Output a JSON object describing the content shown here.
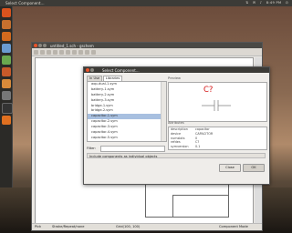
{
  "desktop_panel": {
    "title": "Select Component...",
    "tray": [
      "8:49 PM"
    ]
  },
  "main_window": {
    "title": "untitled_1.sch - gschem",
    "status": {
      "left": "Pick",
      "middle": "Stroke/Repeat/none",
      "right_a": "Grid(100, 100)",
      "right_b": "Component Mode"
    }
  },
  "dialog": {
    "title": "Select Component...",
    "tabs": [
      "In Use",
      "Libraries"
    ],
    "list_items": [
      "aop-dual-1.sym",
      "battery-1.sym",
      "battery-2.sym",
      "battery-3.sym",
      "bridge-1.sym",
      "bridge-2.sym",
      "capacitor-1.sym",
      "capacitor-2.sym",
      "capacitor-3.sym",
      "capacitor-4.sym",
      "capacitor-5.sym"
    ],
    "selected_index": 6,
    "filter_label": "Filter:",
    "filter_value": "",
    "preview_label": "Preview",
    "preview_refdes": "C?",
    "attributes_label": "Attributes",
    "attributes": [
      {
        "name": "description",
        "value": "capacitor"
      },
      {
        "name": "device",
        "value": "CAPACITOR"
      },
      {
        "name": "numslots",
        "value": "0"
      },
      {
        "name": "refdes",
        "value": "C?"
      },
      {
        "name": "symversion",
        "value": "0.1"
      }
    ],
    "option_label": "Include components as individual objects",
    "buttons": {
      "close": "Close",
      "ok": "OK"
    }
  },
  "colors": {
    "panel": "#3c3b37",
    "selection": "#a8c0e0",
    "refdes_red": "#d41414",
    "launcher_accent": "#e07020"
  },
  "launcher_icons": [
    "ubuntu-logo-icon",
    "files-icon",
    "firefox-icon",
    "writer-icon",
    "calc-icon",
    "impress-icon",
    "software-center-icon",
    "settings-icon",
    "terminal-icon",
    "gschem-icon",
    "trash-icon"
  ]
}
